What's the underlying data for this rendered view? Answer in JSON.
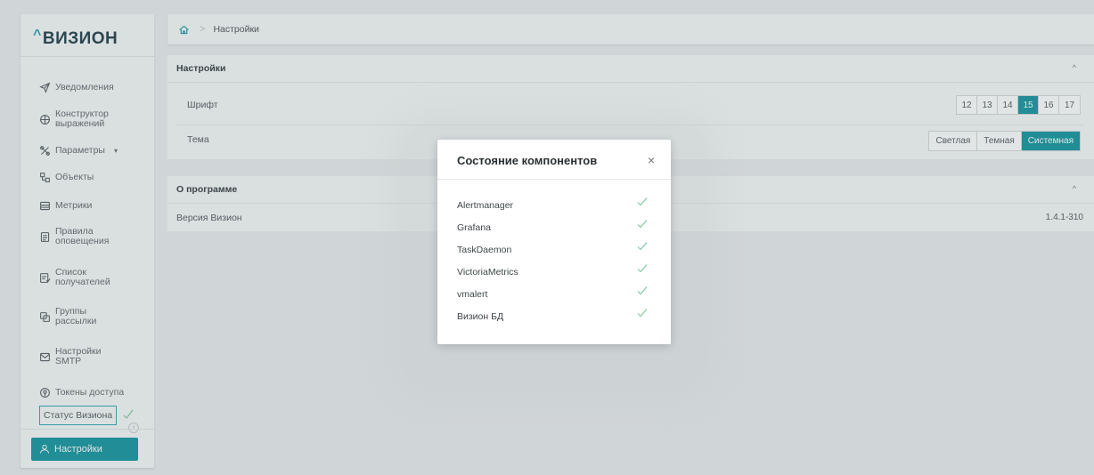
{
  "app": {
    "logo_caret": "^",
    "logo": "ВИЗИОН",
    "accent_color": "#0a8f99"
  },
  "sidebar": {
    "items": [
      {
        "label": "Уведомления",
        "icon": "send-icon"
      },
      {
        "label": "Конструктор выражений",
        "icon": "constructor-icon"
      },
      {
        "label": "Параметры",
        "icon": "parameters-icon",
        "arrow": "▾"
      },
      {
        "label": "Объекты",
        "icon": "objects-icon"
      },
      {
        "label": "Метрики",
        "icon": "metrics-icon"
      },
      {
        "label": "Правила оповещения",
        "icon": "rules-icon"
      },
      {
        "label": "Список получателей",
        "icon": "recipients-icon"
      },
      {
        "label": "Группы рассылки",
        "icon": "groups-icon"
      },
      {
        "label": "Настройки SMTP",
        "icon": "smtp-icon"
      },
      {
        "label": "Токены доступа",
        "icon": "token-icon"
      }
    ],
    "status_item": "Статус Визиона",
    "collapse": "‹",
    "settings_button": "Настройки"
  },
  "breadcrumb": {
    "separator": ">",
    "current": "Настройки"
  },
  "settings_panel": {
    "title": "Настройки",
    "collapse_chevron": "^",
    "font_label": "Шрифт",
    "font_sizes": [
      "12",
      "13",
      "14",
      "15",
      "16",
      "17"
    ],
    "font_selected": "15",
    "theme_label": "Тема",
    "themes": [
      "Светлая",
      "Темная",
      "Системная"
    ],
    "theme_selected": "Системная"
  },
  "about_panel": {
    "title": "О программе",
    "collapse_chevron": "^",
    "version_label": "Версия Визион",
    "version_value": "1.4.1-310"
  },
  "modal": {
    "title": "Состояние компонентов",
    "close": "×",
    "components": [
      {
        "name": "Alertmanager",
        "status": "ok"
      },
      {
        "name": "Grafana",
        "status": "ok"
      },
      {
        "name": "TaskDaemon",
        "status": "ok"
      },
      {
        "name": "VictoriaMetrics",
        "status": "ok"
      },
      {
        "name": "vmalert",
        "status": "ok"
      },
      {
        "name": "Визион БД",
        "status": "ok"
      }
    ],
    "ok_color": "#7bc59a"
  }
}
